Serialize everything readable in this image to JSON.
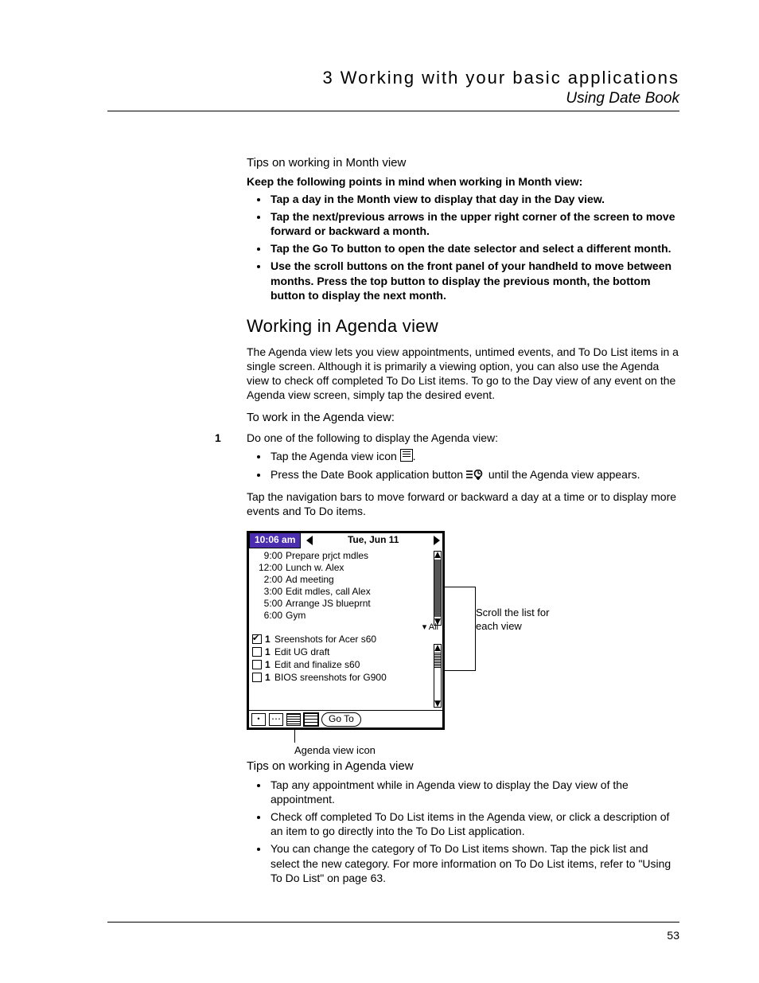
{
  "header": {
    "chapter": "3 Working with your basic applications",
    "section": "Using Date Book"
  },
  "tips_month": {
    "heading": "Tips on working in Month view",
    "intro": "Keep the following points in mind when working in Month view:",
    "items": [
      "Tap a day in the Month view to display that day in the Day view.",
      "Tap the next/previous arrows in the upper right corner of the screen to move forward or backward a month.",
      "Tap the Go To button to open the date selector and select a different month.",
      "Use the scroll buttons on the front panel of your handheld to move between months. Press the top button to display the previous month, the bottom button to display the next month."
    ]
  },
  "agenda": {
    "heading": "Working in Agenda view",
    "para": "The Agenda view lets you view appointments, untimed events, and To Do List items in a single screen. Although it is primarily a viewing option, you can also use the Agenda view to check off completed To Do List items. To go to the Day view of any event on the Agenda view screen, simply tap the desired event.",
    "howto": "To work in the Agenda view:",
    "step_intro": "Do one of the following to display the Agenda view:",
    "step_num": "1",
    "sub": [
      "Tap the Agenda view icon ",
      "Press the Date Book application button ",
      " until the Agenda view appears."
    ],
    "tail": "Tap the navigation bars to move forward or backward a day at a time or to display more events and To Do items."
  },
  "pda": {
    "time": "10:06 am",
    "date": "Tue, Jun 11",
    "events": [
      {
        "t": "9:00",
        "d": "Prepare prjct mdles"
      },
      {
        "t": "12:00",
        "d": "Lunch w. Alex"
      },
      {
        "t": "2:00",
        "d": "Ad meeting"
      },
      {
        "t": "3:00",
        "d": "Edit mdles, call Alex"
      },
      {
        "t": "5:00",
        "d": "Arrange JS blueprnt"
      },
      {
        "t": "6:00",
        "d": "Gym"
      }
    ],
    "category": "All",
    "todos": [
      {
        "c": true,
        "p": "1",
        "d": "Sreenshots for Acer s60"
      },
      {
        "c": false,
        "p": "1",
        "d": "Edit UG draft"
      },
      {
        "c": false,
        "p": "1",
        "d": "Edit and finalize s60"
      },
      {
        "c": false,
        "p": "1",
        "d": "BIOS sreenshots for G900"
      }
    ],
    "goto": "Go To"
  },
  "callouts": {
    "scroll": "Scroll the list for each view",
    "caption": "Agenda view icon"
  },
  "tips_agenda": {
    "heading": "Tips on working in Agenda view",
    "items": [
      "Tap any appointment while in Agenda view to display the Day view of the appointment.",
      "Check off completed To Do List items in the Agenda view, or click a description of an item to go directly into the To Do List application.",
      "You can change the category of To Do List items shown. Tap the pick list and select the new category. For more information on To Do List items, refer to \"Using To Do List\" on page 63."
    ]
  },
  "page": "53"
}
